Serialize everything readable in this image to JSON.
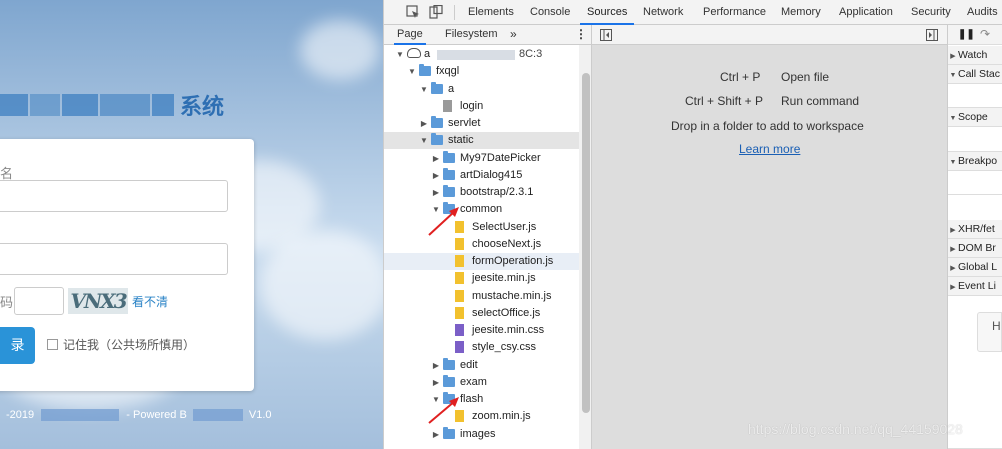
{
  "webpage": {
    "site_title_suffix": "系统",
    "username_label": "名",
    "captcha_label": "码",
    "captcha_text": "VNX3",
    "refresh_link": "看不清",
    "login_button": "录",
    "remember_me": "记住我（公共场所慎用）",
    "footer_year": "-2019",
    "footer_powered": "- Powered B",
    "footer_version": "V1.0"
  },
  "devtools": {
    "tabs": [
      "Elements",
      "Console",
      "Sources",
      "Network",
      "Performance",
      "Memory",
      "Application",
      "Security",
      "Audits"
    ],
    "active_tab": "Sources",
    "navigator_tabs": [
      "Page",
      "Filesystem"
    ],
    "more_tabs": "»",
    "tree": [
      {
        "label": "a",
        "suffix": "8C:3",
        "kind": "cloud",
        "depth": 0,
        "arrow": "down"
      },
      {
        "label": "fxqgl",
        "kind": "folder",
        "depth": 1,
        "arrow": "down"
      },
      {
        "label": "a",
        "kind": "folder",
        "depth": 2,
        "arrow": "down"
      },
      {
        "label": "login",
        "kind": "doc",
        "depth": 3,
        "arrow": ""
      },
      {
        "label": "servlet",
        "kind": "folder",
        "depth": 2,
        "arrow": "right"
      },
      {
        "label": "static",
        "kind": "folder",
        "depth": 2,
        "arrow": "down",
        "selected": true
      },
      {
        "label": "My97DatePicker",
        "kind": "folder",
        "depth": 3,
        "arrow": "right"
      },
      {
        "label": "artDialog415",
        "kind": "folder",
        "depth": 3,
        "arrow": "right"
      },
      {
        "label": "bootstrap/2.3.1",
        "kind": "folder",
        "depth": 3,
        "arrow": "right"
      },
      {
        "label": "common",
        "kind": "folder",
        "depth": 3,
        "arrow": "down"
      },
      {
        "label": "SelectUser.js",
        "kind": "js",
        "depth": 4,
        "arrow": ""
      },
      {
        "label": "chooseNext.js",
        "kind": "js",
        "depth": 4,
        "arrow": ""
      },
      {
        "label": "formOperation.js",
        "kind": "js",
        "depth": 4,
        "arrow": "",
        "highlighted": true
      },
      {
        "label": "jeesite.min.js",
        "kind": "js",
        "depth": 4,
        "arrow": ""
      },
      {
        "label": "mustache.min.js",
        "kind": "js",
        "depth": 4,
        "arrow": ""
      },
      {
        "label": "selectOffice.js",
        "kind": "js",
        "depth": 4,
        "arrow": ""
      },
      {
        "label": "jeesite.min.css",
        "kind": "css",
        "depth": 4,
        "arrow": ""
      },
      {
        "label": "style_csy.css",
        "kind": "css",
        "depth": 4,
        "arrow": ""
      },
      {
        "label": "edit",
        "kind": "folder",
        "depth": 3,
        "arrow": "right"
      },
      {
        "label": "exam",
        "kind": "folder",
        "depth": 3,
        "arrow": "right"
      },
      {
        "label": "flash",
        "kind": "folder",
        "depth": 3,
        "arrow": "down"
      },
      {
        "label": "zoom.min.js",
        "kind": "js",
        "depth": 4,
        "arrow": ""
      },
      {
        "label": "images",
        "kind": "folder",
        "depth": 3,
        "arrow": "right"
      }
    ],
    "editor": {
      "shortcut1_keys": "Ctrl + P",
      "shortcut1_action": "Open file",
      "shortcut2_keys": "Ctrl + Shift + P",
      "shortcut2_action": "Run command",
      "drop_hint": "Drop in a folder to add to workspace",
      "learn_more": "Learn more"
    },
    "debugger_sections": [
      "Watch",
      "Call Stac",
      "Scope",
      "Breakpo",
      "XHR/fet",
      "DOM Br",
      "Global L",
      "Event Li"
    ]
  },
  "watermark": "https://blog.csdn.net/qq_44159028",
  "colors": {
    "accent": "#1a73e8",
    "folder": "#5b9ad9",
    "js_file": "#f2c12e",
    "css_file": "#7b5fc7",
    "arrow_red": "#e02020"
  }
}
